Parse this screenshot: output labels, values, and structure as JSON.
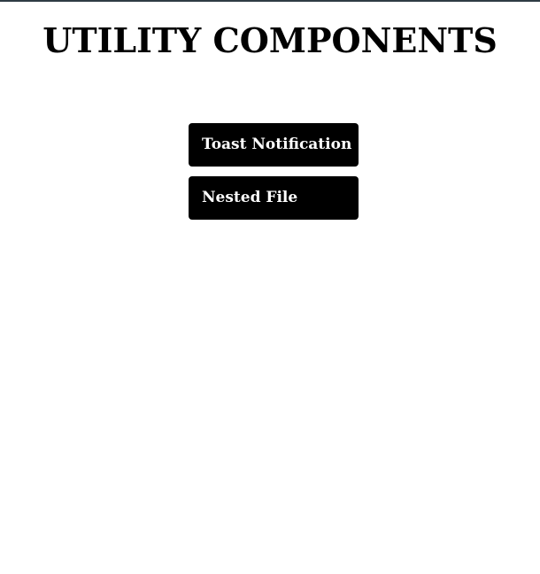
{
  "page": {
    "title": "UTILITY COMPONENTS"
  },
  "menu": {
    "items": [
      {
        "label": "Toast Notification"
      },
      {
        "label": "Nested File"
      }
    ]
  },
  "colors": {
    "background": "#ffffff",
    "button_background": "#000000",
    "button_text": "#ffffff",
    "title_text": "#000000"
  }
}
